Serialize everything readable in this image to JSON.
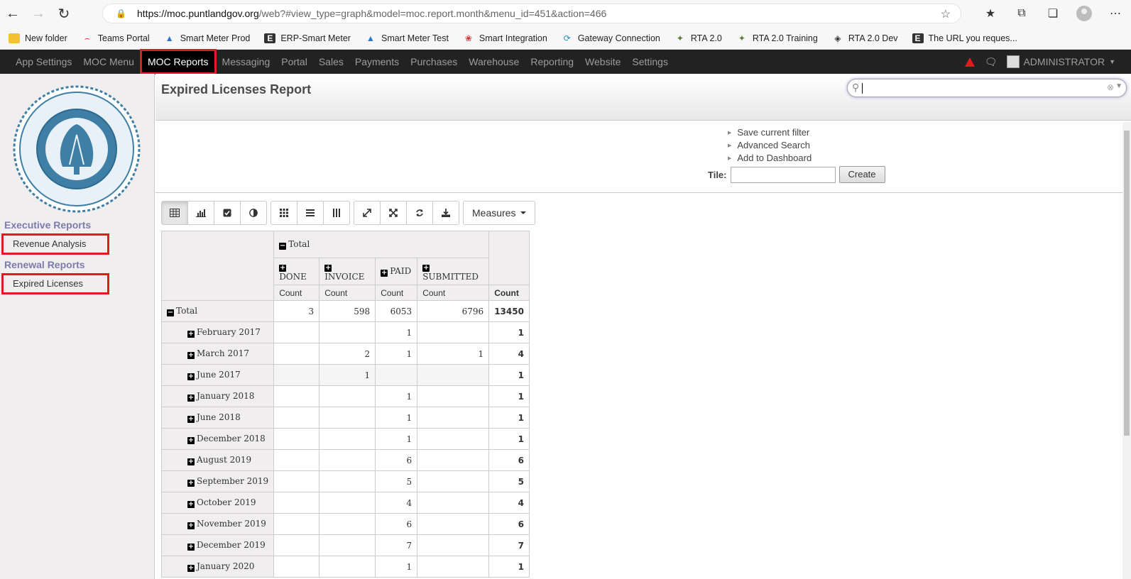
{
  "browser": {
    "url_host": "https://moc.puntlandgov.org",
    "url_rest": "/web?#view_type=graph&model=moc.report.month&menu_id=451&action=466"
  },
  "bookmarks": [
    {
      "label": "New folder",
      "icon": "folder-icon"
    },
    {
      "label": "Teams Portal",
      "icon": "teams-icon"
    },
    {
      "label": "Smart Meter Prod",
      "icon": "drop-icon"
    },
    {
      "label": "ERP-Smart Meter",
      "icon": "e-icon"
    },
    {
      "label": "Smart Meter Test",
      "icon": "drop-icon"
    },
    {
      "label": "Smart Integration",
      "icon": "lotus-icon"
    },
    {
      "label": "Gateway Connection",
      "icon": "swirl-icon"
    },
    {
      "label": "RTA 2.0",
      "icon": "emblem-icon"
    },
    {
      "label": "RTA 2.0 Training",
      "icon": "emblem-icon"
    },
    {
      "label": "RTA 2.0 Dev",
      "icon": "layers-icon"
    },
    {
      "label": "The URL you reques...",
      "icon": "e-icon"
    }
  ],
  "topnav": {
    "items": [
      "App Settings",
      "MOC Menu",
      "MOC Reports",
      "Messaging",
      "Portal",
      "Sales",
      "Payments",
      "Purchases",
      "Warehouse",
      "Reporting",
      "Website",
      "Settings"
    ],
    "active": "MOC Reports",
    "user": "ADMINISTRATOR"
  },
  "sidebar": {
    "sections": [
      {
        "title": "Executive Reports",
        "items": [
          "Revenue Analysis"
        ]
      },
      {
        "title": "Renewal Reports",
        "items": [
          "Expired Licenses"
        ]
      }
    ]
  },
  "page": {
    "title": "Expired Licenses Report",
    "search_value": ""
  },
  "filters": {
    "links": [
      "Save current filter",
      "Advanced Search",
      "Add to Dashboard"
    ],
    "tile_label": "Tile:",
    "create_label": "Create"
  },
  "toolbar": {
    "measures_label": "Measures"
  },
  "pivot": {
    "top_header": "Total",
    "columns": [
      "DONE",
      "INVOICE",
      "PAID",
      "SUBMITTED"
    ],
    "measure": "Count",
    "total_row": {
      "label": "Total",
      "values": [
        "3",
        "598",
        "6053",
        "6796"
      ],
      "total": "13450"
    },
    "rows": [
      {
        "label": "February 2017",
        "values": [
          "",
          "",
          "1",
          ""
        ],
        "total": "1"
      },
      {
        "label": "March 2017",
        "values": [
          "",
          "2",
          "1",
          "1"
        ],
        "total": "4"
      },
      {
        "label": "June 2017",
        "values": [
          "",
          "1",
          "",
          ""
        ],
        "total": "1"
      },
      {
        "label": "January 2018",
        "values": [
          "",
          "",
          "1",
          ""
        ],
        "total": "1"
      },
      {
        "label": "June 2018",
        "values": [
          "",
          "",
          "1",
          ""
        ],
        "total": "1"
      },
      {
        "label": "December 2018",
        "values": [
          "",
          "",
          "1",
          ""
        ],
        "total": "1"
      },
      {
        "label": "August 2019",
        "values": [
          "",
          "",
          "6",
          ""
        ],
        "total": "6"
      },
      {
        "label": "September 2019",
        "values": [
          "",
          "",
          "5",
          ""
        ],
        "total": "5"
      },
      {
        "label": "October 2019",
        "values": [
          "",
          "",
          "4",
          ""
        ],
        "total": "4"
      },
      {
        "label": "November 2019",
        "values": [
          "",
          "",
          "6",
          ""
        ],
        "total": "6"
      },
      {
        "label": "December 2019",
        "values": [
          "",
          "",
          "7",
          ""
        ],
        "total": "7"
      },
      {
        "label": "January 2020",
        "values": [
          "",
          "",
          "1",
          ""
        ],
        "total": "1"
      }
    ]
  },
  "colors": {
    "accent": "#7c7bad",
    "highlight": "#e21b23",
    "nav_bg": "#222222"
  }
}
